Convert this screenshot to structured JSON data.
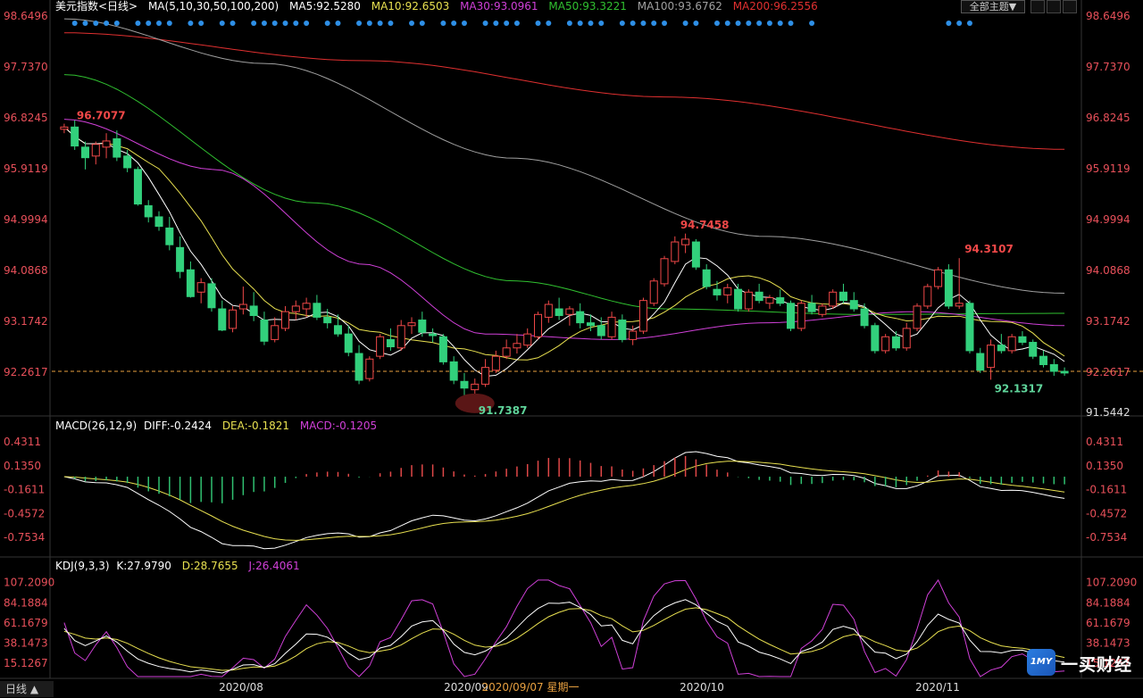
{
  "header": {
    "symbol_label": "美元指数<日线>",
    "ma_params": "MA(5,10,30,50,100,200)",
    "ma5": "MA5:92.5280",
    "ma10": "MA10:92.6503",
    "ma30": "MA30:93.0961",
    "ma50": "MA50:93.3221",
    "ma100": "MA100:93.6762",
    "ma200": "MA200:96.2556",
    "theme_button": "全部主题▼"
  },
  "colors": {
    "up": "#f04848",
    "down": "#32d07c",
    "ma5": "#ffffff",
    "ma10": "#e8e050",
    "ma30": "#d040d8",
    "ma50": "#30c030",
    "ma100": "#a0a0a0",
    "ma200": "#e03030",
    "axis_text": "#e8505a",
    "macd_pos": "#e04848",
    "macd_neg": "#30c070",
    "dif": "#ffffff",
    "dea": "#e8e050",
    "kdj_k": "#ffffff",
    "kdj_d": "#e8e050",
    "kdj_j": "#d040d8"
  },
  "chart_data": [
    {
      "type": "candlestick",
      "title": "美元指数<日线>",
      "y_ticks": [
        "98.6496",
        "97.7370",
        "96.8245",
        "95.9119",
        "94.9994",
        "94.0868",
        "93.1742",
        "92.2617",
        "91.5442"
      ],
      "ylim": [
        91.5442,
        98.6496
      ],
      "current_price_line": 92.28,
      "annotations": [
        "96.7077",
        "94.7458",
        "94.3107",
        "91.7387",
        "92.1317"
      ],
      "x_labels": [
        "2020/08",
        "2020/09",
        "2020/09/07 星期一",
        "2020/10",
        "2020/11"
      ],
      "candles": [
        [
          96.62,
          96.72,
          96.55,
          96.66
        ],
        [
          96.66,
          96.78,
          96.25,
          96.32
        ],
        [
          96.3,
          96.4,
          95.9,
          96.11
        ],
        [
          96.14,
          96.4,
          95.99,
          96.35
        ],
        [
          96.3,
          96.55,
          96.1,
          96.41
        ],
        [
          96.45,
          96.6,
          96.05,
          96.12
        ],
        [
          96.14,
          96.25,
          95.85,
          95.93
        ],
        [
          95.9,
          95.95,
          95.25,
          95.28
        ],
        [
          95.25,
          95.35,
          94.95,
          95.05
        ],
        [
          95.05,
          95.15,
          94.8,
          94.88
        ],
        [
          94.85,
          95.05,
          94.45,
          94.55
        ],
        [
          94.5,
          94.7,
          93.95,
          94.07
        ],
        [
          94.1,
          94.25,
          93.6,
          93.62
        ],
        [
          93.7,
          93.95,
          93.5,
          93.87
        ],
        [
          93.85,
          93.95,
          93.35,
          93.42
        ],
        [
          93.4,
          93.55,
          93.0,
          93.02
        ],
        [
          93.05,
          93.45,
          92.98,
          93.38
        ],
        [
          93.4,
          93.8,
          93.3,
          93.48
        ],
        [
          93.45,
          93.7,
          93.18,
          93.28
        ],
        [
          93.2,
          93.35,
          92.75,
          92.82
        ],
        [
          92.85,
          93.25,
          92.8,
          93.1
        ],
        [
          93.05,
          93.45,
          93.0,
          93.35
        ],
        [
          93.35,
          93.55,
          93.2,
          93.45
        ],
        [
          93.4,
          93.6,
          93.25,
          93.5
        ],
        [
          93.5,
          93.65,
          93.2,
          93.25
        ],
        [
          93.25,
          93.4,
          93.05,
          93.15
        ],
        [
          93.1,
          93.3,
          92.9,
          92.95
        ],
        [
          92.95,
          93.1,
          92.55,
          92.62
        ],
        [
          92.6,
          92.75,
          92.05,
          92.12
        ],
        [
          92.15,
          92.55,
          92.1,
          92.5
        ],
        [
          92.55,
          92.95,
          92.5,
          92.9
        ],
        [
          92.85,
          93.05,
          92.65,
          92.72
        ],
        [
          92.7,
          93.2,
          92.65,
          93.1
        ],
        [
          93.1,
          93.25,
          92.95,
          93.15
        ],
        [
          93.2,
          93.35,
          92.9,
          92.98
        ],
        [
          92.95,
          93.05,
          92.8,
          92.92
        ],
        [
          92.9,
          92.95,
          92.4,
          92.45
        ],
        [
          92.45,
          92.55,
          92.05,
          92.12
        ],
        [
          92.1,
          92.25,
          91.85,
          91.98
        ],
        [
          91.95,
          92.15,
          91.74,
          92.05
        ],
        [
          92.05,
          92.5,
          92.0,
          92.35
        ],
        [
          92.3,
          92.65,
          92.25,
          92.55
        ],
        [
          92.55,
          92.85,
          92.5,
          92.7
        ],
        [
          92.7,
          92.95,
          92.6,
          92.78
        ],
        [
          92.75,
          93.05,
          92.7,
          92.95
        ],
        [
          92.9,
          93.35,
          92.85,
          93.3
        ],
        [
          93.25,
          93.55,
          93.15,
          93.48
        ],
        [
          93.4,
          93.6,
          93.2,
          93.28
        ],
        [
          93.3,
          93.45,
          93.1,
          93.4
        ],
        [
          93.35,
          93.5,
          93.05,
          93.15
        ],
        [
          93.15,
          93.3,
          93.0,
          93.1
        ],
        [
          93.1,
          93.25,
          92.85,
          92.92
        ],
        [
          92.9,
          93.35,
          92.85,
          93.25
        ],
        [
          93.2,
          93.3,
          92.8,
          92.85
        ],
        [
          92.85,
          93.1,
          92.75,
          93.0
        ],
        [
          93.0,
          93.6,
          92.95,
          93.55
        ],
        [
          93.5,
          93.95,
          93.45,
          93.9
        ],
        [
          93.85,
          94.35,
          93.8,
          94.3
        ],
        [
          94.25,
          94.7,
          94.2,
          94.6
        ],
        [
          94.55,
          94.75,
          94.4,
          94.65
        ],
        [
          94.6,
          94.65,
          94.1,
          94.15
        ],
        [
          94.1,
          94.2,
          93.75,
          93.8
        ],
        [
          93.75,
          93.9,
          93.55,
          93.65
        ],
        [
          93.65,
          93.85,
          93.5,
          93.78
        ],
        [
          93.75,
          93.85,
          93.35,
          93.4
        ],
        [
          93.4,
          93.75,
          93.35,
          93.7
        ],
        [
          93.7,
          93.85,
          93.5,
          93.55
        ],
        [
          93.5,
          93.65,
          93.4,
          93.6
        ],
        [
          93.6,
          93.75,
          93.45,
          93.5
        ],
        [
          93.5,
          93.55,
          93.0,
          93.05
        ],
        [
          93.05,
          93.55,
          93.0,
          93.5
        ],
        [
          93.5,
          93.65,
          93.3,
          93.35
        ],
        [
          93.3,
          93.5,
          93.25,
          93.45
        ],
        [
          93.45,
          93.75,
          93.4,
          93.7
        ],
        [
          93.7,
          93.85,
          93.5,
          93.55
        ],
        [
          93.55,
          93.7,
          93.35,
          93.4
        ],
        [
          93.4,
          93.5,
          93.05,
          93.1
        ],
        [
          93.1,
          93.15,
          92.6,
          92.65
        ],
        [
          92.65,
          92.95,
          92.6,
          92.9
        ],
        [
          92.9,
          93.0,
          92.65,
          92.7
        ],
        [
          92.7,
          93.15,
          92.65,
          93.05
        ],
        [
          93.05,
          93.5,
          93.0,
          93.45
        ],
        [
          93.45,
          93.85,
          93.4,
          93.8
        ],
        [
          93.8,
          94.15,
          93.75,
          94.1
        ],
        [
          94.1,
          94.2,
          93.4,
          93.45
        ],
        [
          93.45,
          94.31,
          93.4,
          93.5
        ],
        [
          93.5,
          93.55,
          92.6,
          92.65
        ],
        [
          92.6,
          92.7,
          92.25,
          92.3
        ],
        [
          92.35,
          92.85,
          92.13,
          92.75
        ],
        [
          92.75,
          92.95,
          92.6,
          92.65
        ],
        [
          92.65,
          92.95,
          92.6,
          92.9
        ],
        [
          92.9,
          93.0,
          92.75,
          92.8
        ],
        [
          92.8,
          92.85,
          92.5,
          92.55
        ],
        [
          92.55,
          92.65,
          92.35,
          92.4
        ],
        [
          92.4,
          92.5,
          92.2,
          92.28
        ],
        [
          92.28,
          92.35,
          92.2,
          92.25
        ]
      ]
    },
    {
      "type": "macd",
      "title": "MACD(26,12,9)",
      "dif_label": "DIFF:-0.2424",
      "dea_label": "DEA:-0.1821",
      "macd_label": "MACD:-0.1205",
      "y_ticks": [
        "0.4311",
        "0.1350",
        "-0.1611",
        "-0.4572",
        "-0.7534"
      ],
      "ylim": [
        -0.95,
        0.52
      ]
    },
    {
      "type": "kdj",
      "title": "KDJ(9,3,3)",
      "k_label": "K:27.9790",
      "d_label": "D:28.7655",
      "j_label": "J:26.4061",
      "y_ticks": [
        "107.2090",
        "84.1884",
        "61.1679",
        "38.1473",
        "15.1267"
      ],
      "ylim": [
        0,
        115
      ]
    }
  ],
  "bottom": {
    "period_tab": "日线 ▲",
    "brand": "一买财经",
    "brand_badge": "1MY"
  }
}
